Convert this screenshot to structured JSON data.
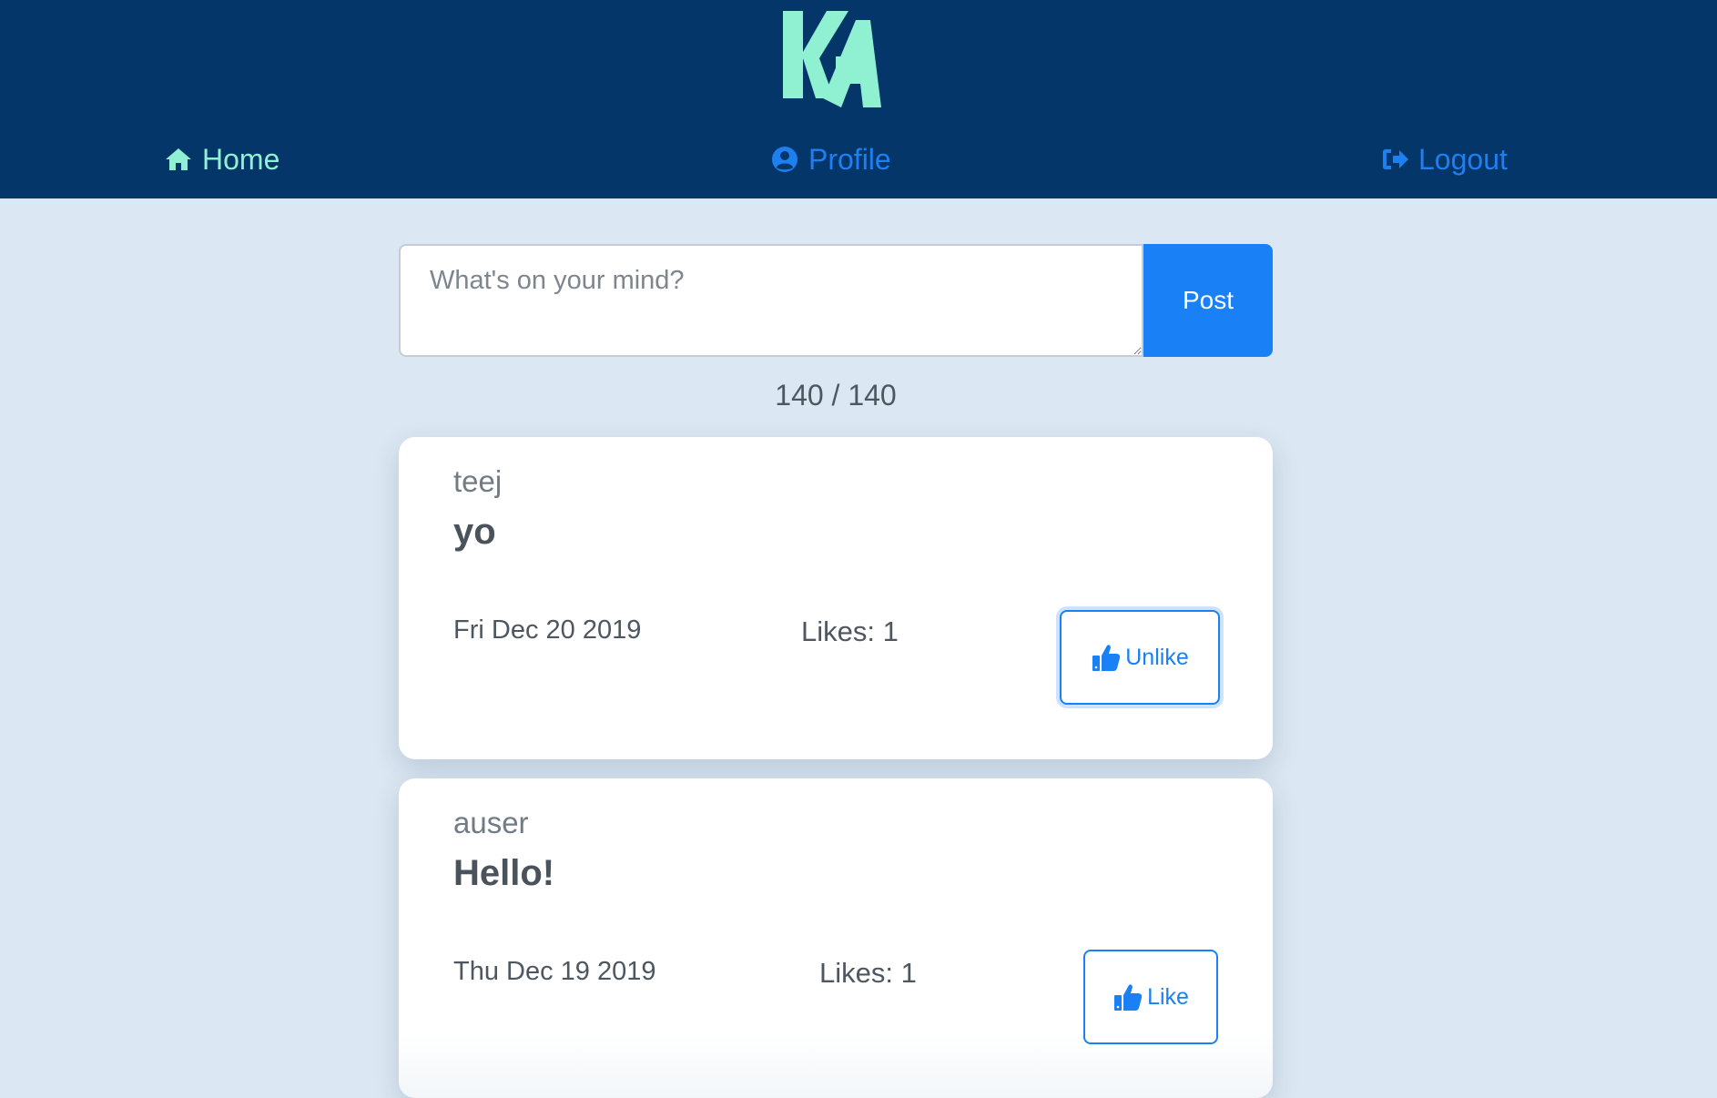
{
  "header": {
    "logo_text": "KA",
    "nav": {
      "home": "Home",
      "profile": "Profile",
      "logout": "Logout"
    }
  },
  "composer": {
    "placeholder": "What's on your mind?",
    "value": "",
    "post_label": "Post",
    "char_count": "140 / 140"
  },
  "posts": [
    {
      "author": "teej",
      "content": "yo",
      "date": "Fri Dec 20 2019",
      "likes": "Likes: 1",
      "button_label": "Unlike",
      "button_icon": "thumbs-up-icon"
    },
    {
      "author": "auser",
      "content": "Hello!",
      "date": "Thu Dec 19 2019",
      "likes": "Likes: 1",
      "button_label": "Like",
      "button_icon": "thumbs-up-icon"
    }
  ],
  "colors": {
    "header_bg": "#04366a",
    "page_bg": "#dbe7f2",
    "accent": "#1a80f5",
    "mint": "#8ff0d2"
  }
}
